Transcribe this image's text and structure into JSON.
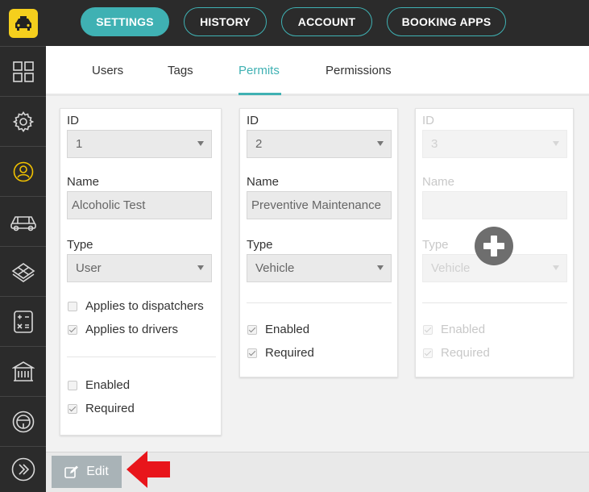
{
  "nav": {
    "pills": [
      {
        "label": "SETTINGS",
        "active": true
      },
      {
        "label": "HISTORY",
        "active": false
      },
      {
        "label": "ACCOUNT",
        "active": false
      },
      {
        "label": "BOOKING APPS",
        "active": false
      }
    ]
  },
  "sidebar": {
    "items": [
      {
        "icon": "dashboard-grid-icon"
      },
      {
        "icon": "gear-icon"
      },
      {
        "icon": "user-circle-icon",
        "active": true
      },
      {
        "icon": "car-icon"
      },
      {
        "icon": "map-icon"
      },
      {
        "icon": "calculator-icon"
      },
      {
        "icon": "building-icon"
      },
      {
        "icon": "steering-wheel-icon"
      },
      {
        "icon": "chevron-double-right-icon"
      }
    ]
  },
  "tabs": [
    {
      "label": "Users"
    },
    {
      "label": "Tags"
    },
    {
      "label": "Permits",
      "active": true
    },
    {
      "label": "Permissions"
    }
  ],
  "labels": {
    "id": "ID",
    "name": "Name",
    "type": "Type"
  },
  "permits": [
    {
      "id": "1",
      "name": "Alcoholic Test",
      "type": "User",
      "applies_dispatchers": {
        "label": "Applies to dispatchers",
        "checked": false
      },
      "applies_drivers": {
        "label": "Applies to drivers",
        "checked": true
      },
      "enabled": {
        "label": "Enabled",
        "checked": false
      },
      "required": {
        "label": "Required",
        "checked": true
      }
    },
    {
      "id": "2",
      "name": "Preventive Maintenance",
      "type": "Vehicle",
      "enabled": {
        "label": "Enabled",
        "checked": true
      },
      "required": {
        "label": "Required",
        "checked": true
      }
    },
    {
      "id": "3",
      "name": "",
      "type": "Vehicle",
      "enabled": {
        "label": "Enabled",
        "checked": true
      },
      "required": {
        "label": "Required",
        "checked": true
      },
      "placeholder": true
    }
  ],
  "footer": {
    "edit_label": "Edit"
  },
  "colors": {
    "accent": "#3fb1b3",
    "sidebar_bg": "#2b2b2b",
    "logo": "#f5cf1d",
    "annotation_arrow": "#e8151b"
  }
}
